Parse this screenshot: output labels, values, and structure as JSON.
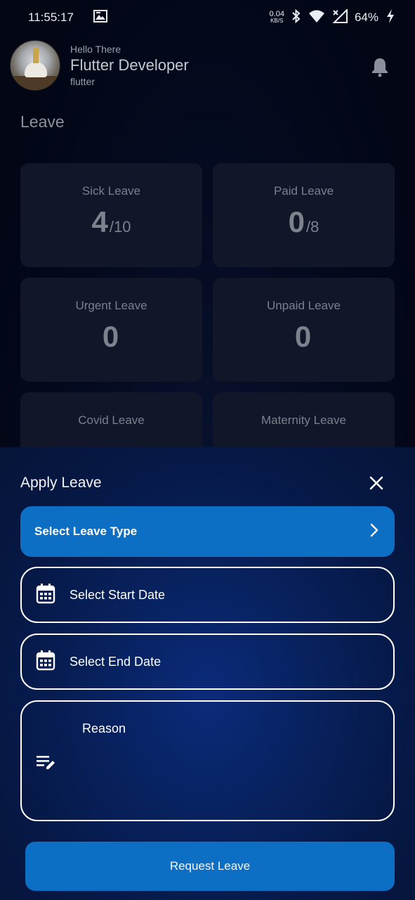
{
  "status_bar": {
    "time": "11:55:17",
    "net_speed_value": "0.04",
    "net_speed_unit": "KB/S",
    "battery_percent": "64%"
  },
  "profile": {
    "greeting": "Hello There",
    "name": "Flutter Developer",
    "username": "flutter"
  },
  "section": {
    "title": "Leave"
  },
  "leave_cards": [
    {
      "title": "Sick Leave",
      "value": "4",
      "total": "/10"
    },
    {
      "title": "Paid Leave",
      "value": "0",
      "total": "/8"
    },
    {
      "title": "Urgent Leave",
      "value": "0",
      "total": ""
    },
    {
      "title": "Unpaid Leave",
      "value": "0",
      "total": ""
    },
    {
      "title": "Covid Leave",
      "value": "",
      "total": ""
    },
    {
      "title": "Maternity Leave",
      "value": "",
      "total": ""
    }
  ],
  "apply_sheet": {
    "title": "Apply Leave",
    "leave_type_label": "Select Leave Type",
    "start_date_label": "Select Start Date",
    "end_date_label": "Select End Date",
    "reason_placeholder": "Reason",
    "submit_label": "Request Leave"
  },
  "colors": {
    "accent": "#0c6fc4",
    "sheet_background": "#08225f",
    "card_background": "#111628",
    "page_background": "#020615"
  },
  "icons": {
    "status": [
      "photo-app-icon",
      "bluetooth-icon",
      "wifi-icon",
      "signal-icon",
      "battery-charging-icon"
    ],
    "header": "bell-icon",
    "sheet_close": "close-icon",
    "leave_type": "chevron-right-icon",
    "date_fields": "calendar-icon",
    "reason_field": "edit-note-icon"
  }
}
